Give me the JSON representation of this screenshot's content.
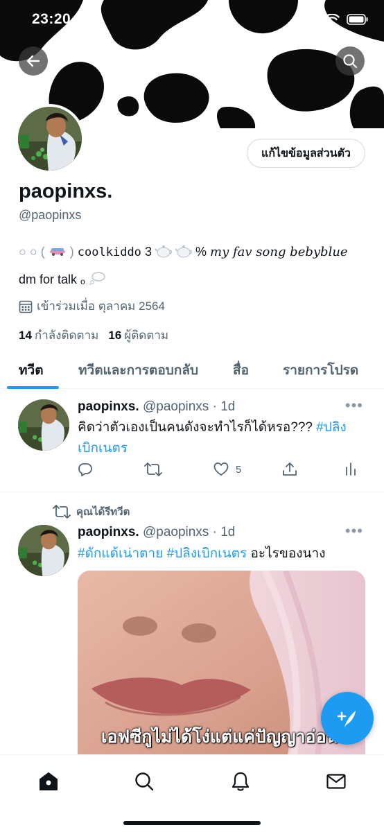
{
  "status_bar": {
    "time": "23:20"
  },
  "profile": {
    "edit_button": "แก้ไขข้อมูลส่วนตัว",
    "display_name": "paopinxs.",
    "handle": "@paopinxs",
    "bio_prefix": "○ ○ (",
    "bio_suffix": ")",
    "bio_mono": "coolkiddo",
    "bio_num": "3",
    "bio_percent": "%",
    "bio_serif": "my fav song bebyblue",
    "bio_line2": "dm for talk ₒ",
    "joined": "เข้าร่วมเมื่อ ตุลาคม 2564",
    "following_count": "14",
    "following_label": "กำลังติดตาม",
    "followers_count": "16",
    "followers_label": "ผู้ติดตาม"
  },
  "tabs": [
    {
      "label": "ทวีต",
      "active": true
    },
    {
      "label": "ทวีตและการตอบกลับ",
      "active": false
    },
    {
      "label": "สื่อ",
      "active": false
    },
    {
      "label": "รายการโปรด",
      "active": false
    }
  ],
  "tweets": [
    {
      "name": "paopinxs.",
      "meta": "@paopinxs · 1d",
      "text_line1": "คิดว่าตัวเองเป็นคนดังจะทำไรก็ได้หรอ???",
      "hashtag_line1": "#ปลิง",
      "hashtag_line2": "เบิกเนตร",
      "likes": "5"
    },
    {
      "retweet_note": "คุณได้รีทวีต",
      "name": "paopinxs.",
      "meta": "@paopinxs · 1d",
      "hashtag_a": "#ดักแด้เน่าตาย",
      "hashtag_b": "#ปลิงเบิกเนตร",
      "text_tail": "อะไรของนาง",
      "media_caption": "เอฟซีกูไม่ได้โง่แต่แค่ปัญญาอ่อน"
    }
  ],
  "icons": {
    "back": "arrow-left-icon",
    "search": "search-icon",
    "calendar": "calendar-icon",
    "reply": "reply-icon",
    "retweet": "retweet-icon",
    "like": "heart-icon",
    "share": "share-icon",
    "analytics": "analytics-icon",
    "compose": "compose-icon",
    "home": "home-icon",
    "explore": "search-icon",
    "notifications": "bell-icon",
    "messages": "mail-icon"
  },
  "colors": {
    "accent": "#1d9bf0",
    "text_primary": "#0f1419",
    "text_secondary": "#536471"
  }
}
